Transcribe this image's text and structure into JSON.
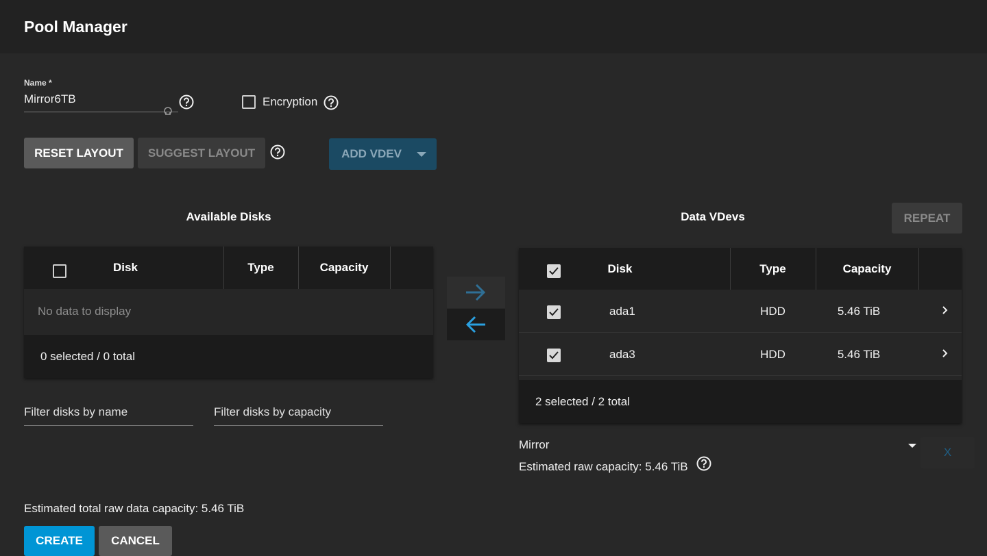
{
  "header": {
    "title": "Pool Manager"
  },
  "name_field": {
    "label": "Name *",
    "value": "Mirror6TB"
  },
  "encryption": {
    "label": "Encryption",
    "checked": false
  },
  "buttons": {
    "reset_layout": "RESET LAYOUT",
    "suggest_layout": "SUGGEST LAYOUT",
    "add_vdev": "ADD VDEV",
    "repeat": "REPEAT",
    "create": "CREATE",
    "cancel": "CANCEL",
    "remove_vdev": "X"
  },
  "available_disks": {
    "title": "Available Disks",
    "columns": [
      "Disk",
      "Type",
      "Capacity"
    ],
    "empty_text": "No data to display",
    "footer": "0 selected / 0 total"
  },
  "filters": {
    "by_name": "Filter disks by name",
    "by_capacity": "Filter disks by capacity"
  },
  "data_vdevs": {
    "title": "Data VDevs",
    "columns": [
      "Disk",
      "Type",
      "Capacity"
    ],
    "rows": [
      {
        "disk": "ada1",
        "type": "HDD",
        "capacity": "5.46 TiB",
        "checked": true
      },
      {
        "disk": "ada3",
        "type": "HDD",
        "capacity": "5.46 TiB",
        "checked": true
      }
    ],
    "footer": "2 selected / 2 total",
    "layout": "Mirror",
    "estimated_raw": "Estimated raw capacity: 5.46 TiB"
  },
  "estimated_total": "Estimated total raw data capacity: 5.46 TiB",
  "colors": {
    "accent": "#0095d5",
    "add_vdev_bg": "#1b4a63",
    "arrow_right": "#2f6f95",
    "arrow_left": "#2aa0e0"
  }
}
